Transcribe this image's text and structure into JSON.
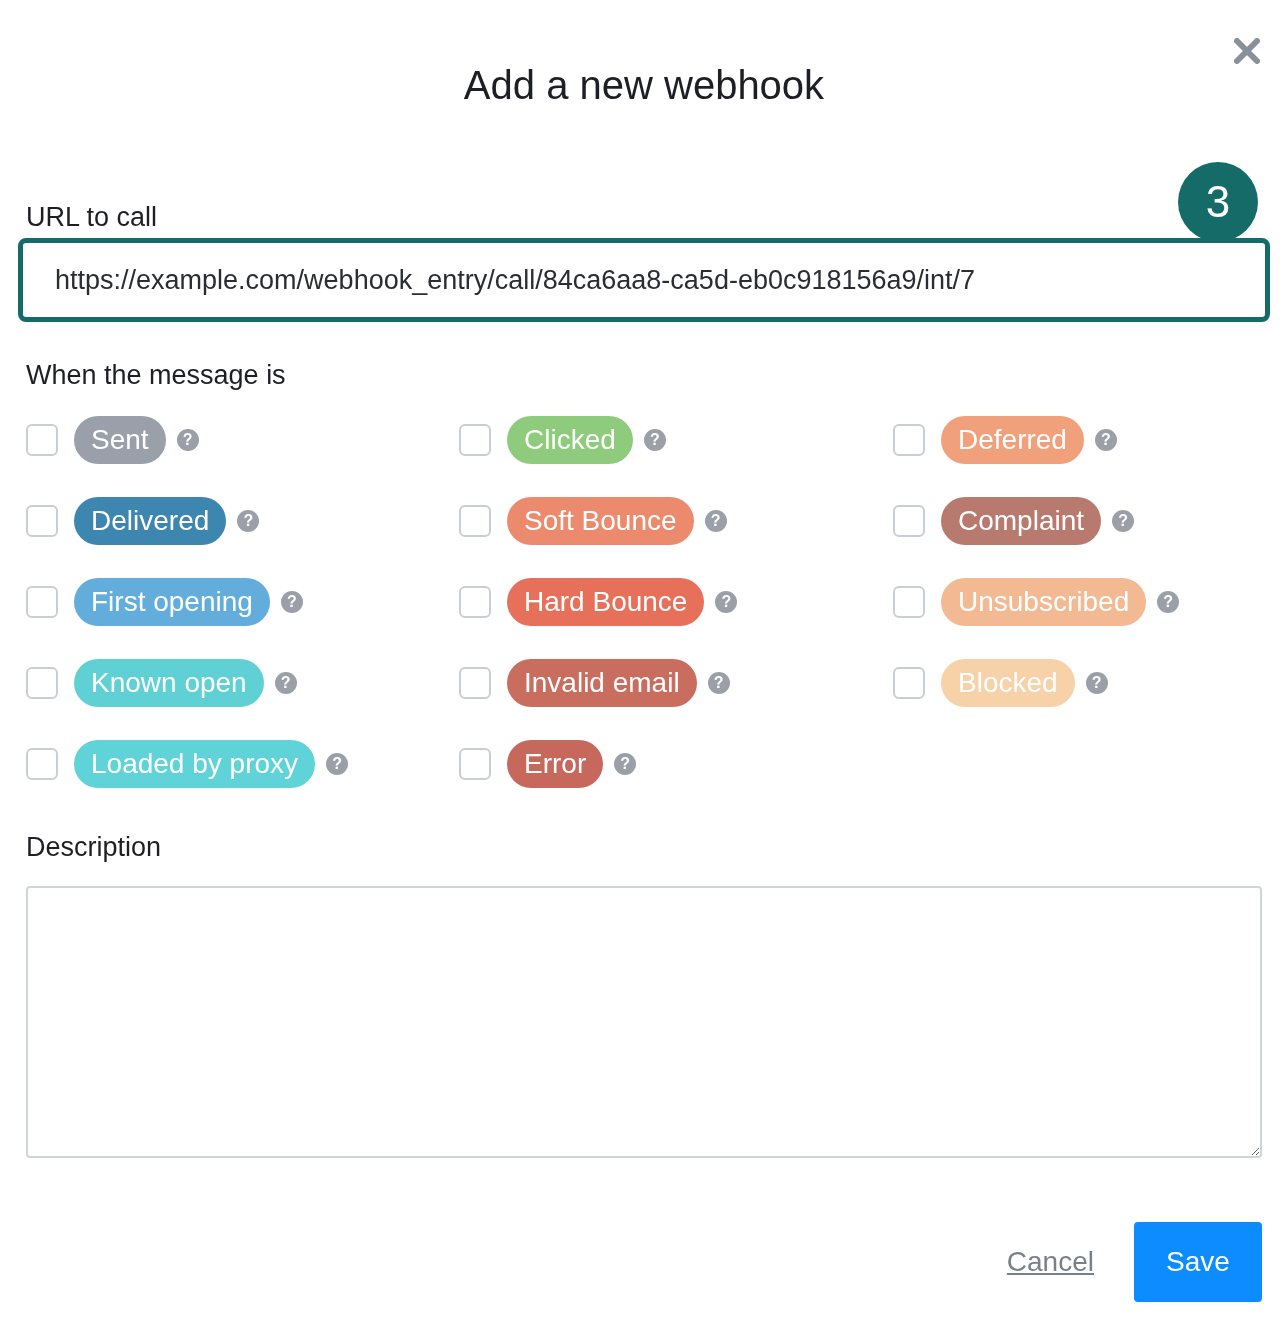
{
  "dialog": {
    "title": "Add a new webhook",
    "step": "3"
  },
  "url": {
    "label": "URL to call",
    "value": "https://example.com/webhook_entry/call/84ca6aa8-ca5d-eb0c918156a9/int/7"
  },
  "events_label": "When the message is",
  "events": [
    {
      "label": "Sent",
      "color": "#9aa0aa",
      "checked": false,
      "help": "?"
    },
    {
      "label": "Clicked",
      "color": "#8fcb7c",
      "checked": false,
      "help": "?"
    },
    {
      "label": "Deferred",
      "color": "#f0a07a",
      "checked": false,
      "help": "?"
    },
    {
      "label": "Delivered",
      "color": "#3d86b0",
      "checked": false,
      "help": "?"
    },
    {
      "label": "Soft Bounce",
      "color": "#ec8a6e",
      "checked": false,
      "help": "?"
    },
    {
      "label": "Complaint",
      "color": "#b87a6e",
      "checked": false,
      "help": "?"
    },
    {
      "label": "First opening",
      "color": "#63addc",
      "checked": false,
      "help": "?"
    },
    {
      "label": "Hard Bounce",
      "color": "#e7705a",
      "checked": false,
      "help": "?"
    },
    {
      "label": "Unsubscribed",
      "color": "#f3b993",
      "checked": false,
      "help": "?"
    },
    {
      "label": "Known open",
      "color": "#5fd0d3",
      "checked": false,
      "help": "?"
    },
    {
      "label": "Invalid email",
      "color": "#c96d5f",
      "checked": false,
      "help": "?"
    },
    {
      "label": "Blocked",
      "color": "#f7d1a8",
      "checked": false,
      "help": "?"
    },
    {
      "label": "Loaded by proxy",
      "color": "#5fd3d8",
      "checked": false,
      "help": "?"
    },
    {
      "label": "Error",
      "color": "#c7685c",
      "checked": false,
      "help": "?"
    }
  ],
  "description": {
    "label": "Description"
  },
  "buttons": {
    "cancel": "Cancel",
    "save": "Save"
  }
}
